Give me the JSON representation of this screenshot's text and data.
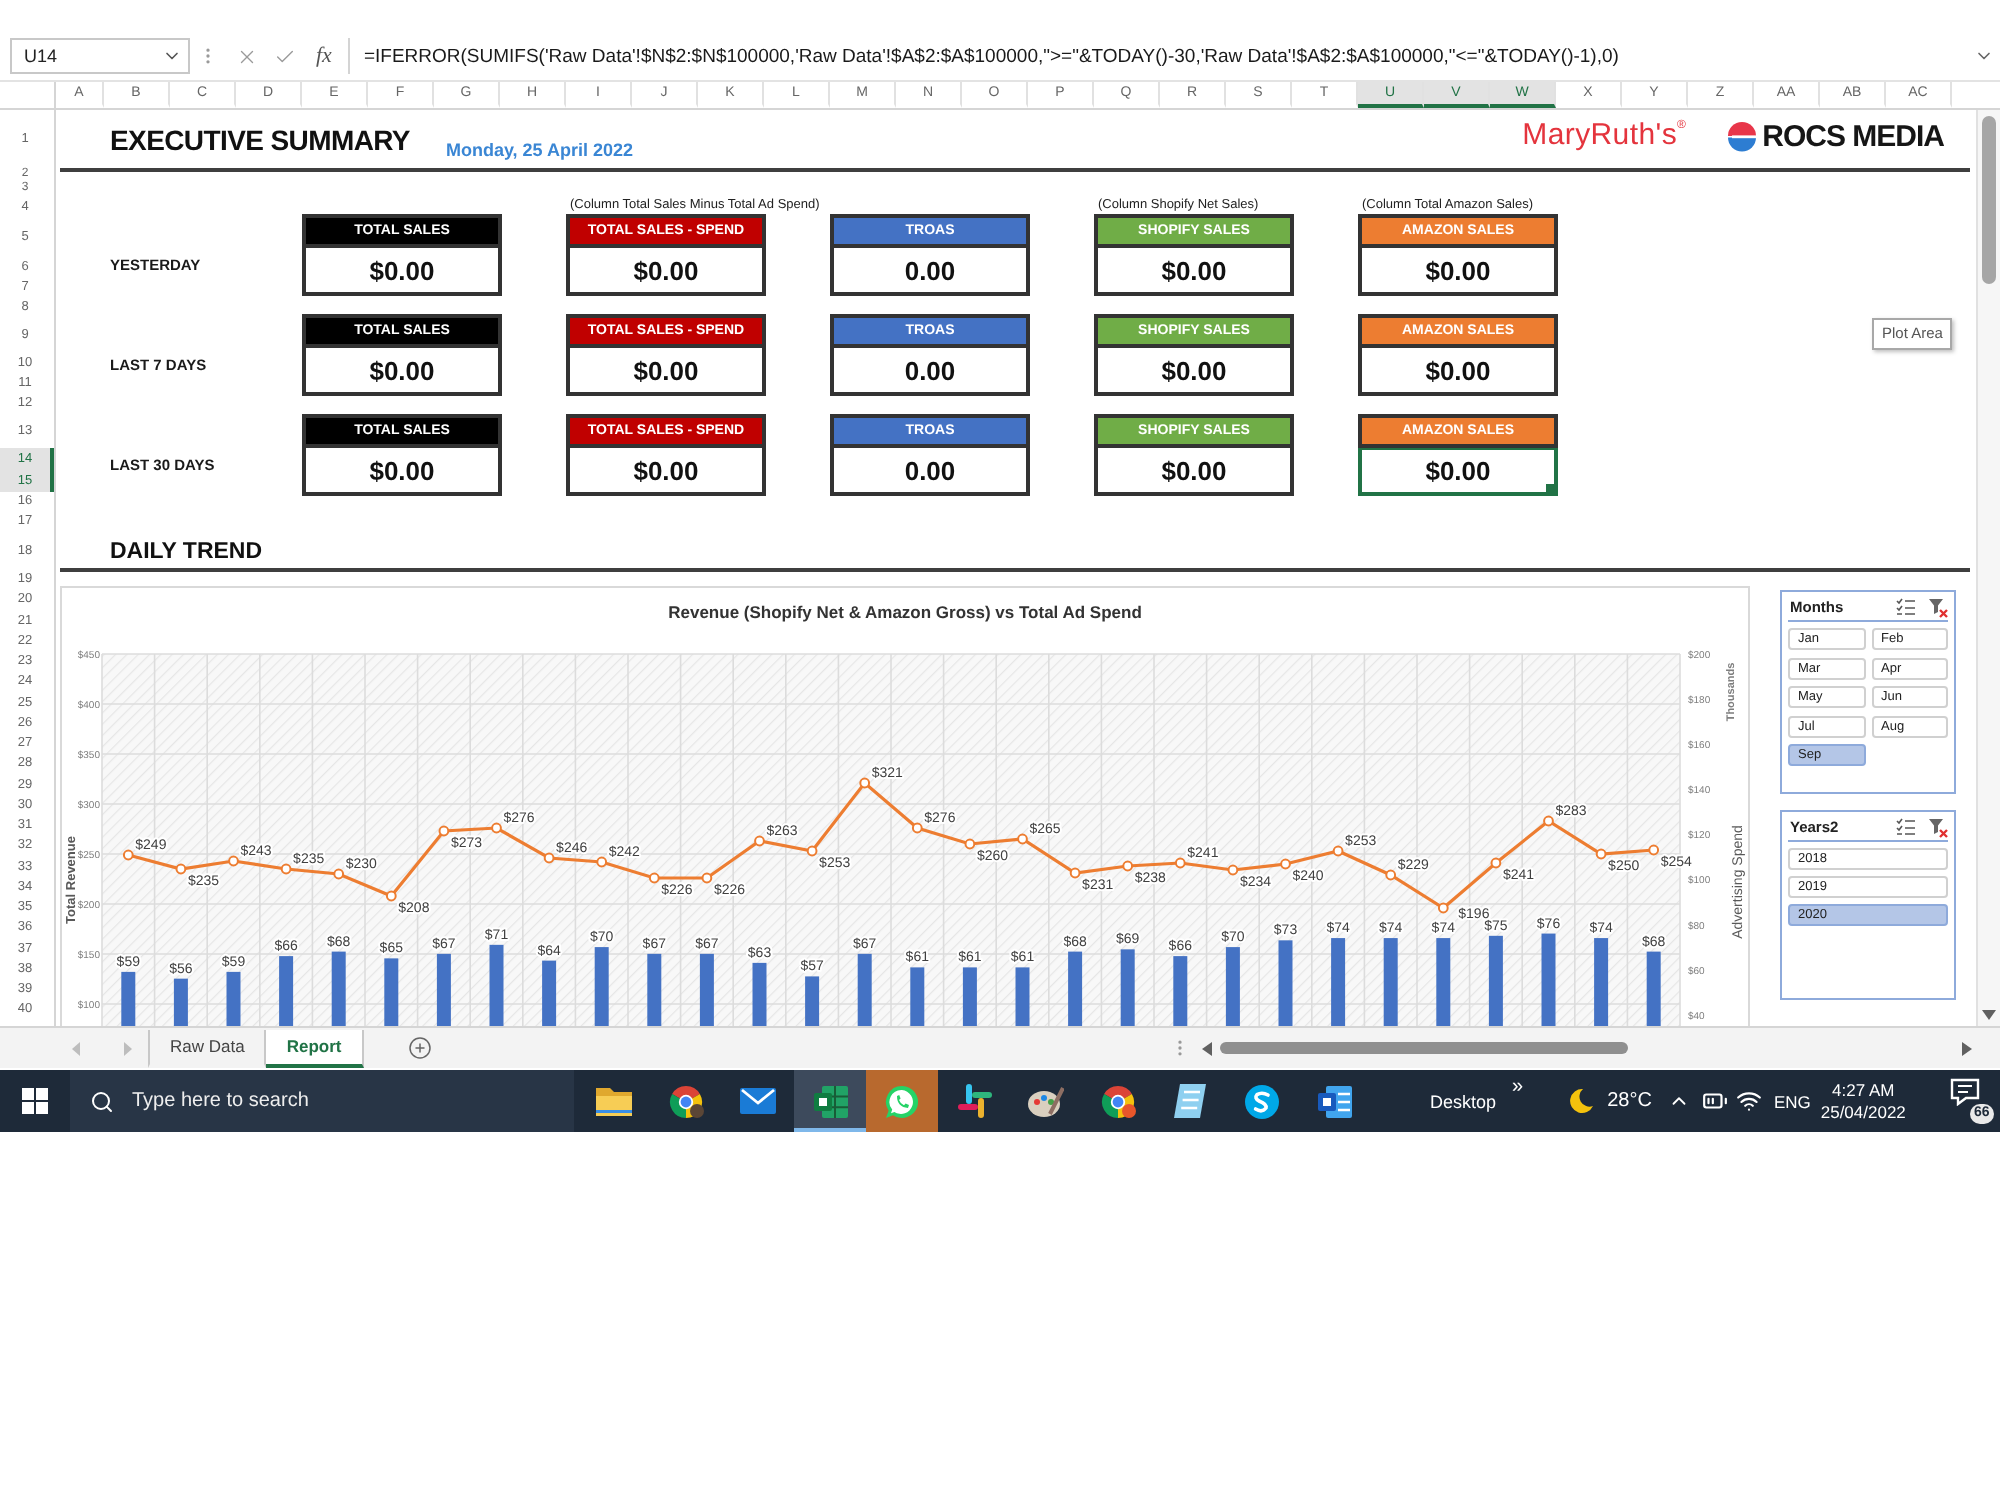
{
  "formula_bar": {
    "name_box": "U14",
    "function_label": "fx",
    "formula": "=IFERROR(SUMIFS('Raw Data'!$N$2:$N$100000,'Raw Data'!$A$2:$A$100000,\">=\"&TODAY()-30,'Raw Data'!$A$2:$A$100000,\"<=\"&TODAY()-1),0)"
  },
  "columns": [
    {
      "label": "A",
      "selected": false
    },
    {
      "label": "B",
      "selected": false
    },
    {
      "label": "C",
      "selected": false
    },
    {
      "label": "D",
      "selected": false
    },
    {
      "label": "E",
      "selected": false
    },
    {
      "label": "F",
      "selected": false
    },
    {
      "label": "G",
      "selected": false
    },
    {
      "label": "H",
      "selected": false
    },
    {
      "label": "I",
      "selected": false
    },
    {
      "label": "J",
      "selected": false
    },
    {
      "label": "K",
      "selected": false
    },
    {
      "label": "L",
      "selected": false
    },
    {
      "label": "M",
      "selected": false
    },
    {
      "label": "N",
      "selected": false
    },
    {
      "label": "O",
      "selected": false
    },
    {
      "label": "P",
      "selected": false
    },
    {
      "label": "Q",
      "selected": false
    },
    {
      "label": "R",
      "selected": false
    },
    {
      "label": "S",
      "selected": false
    },
    {
      "label": "T",
      "selected": false
    },
    {
      "label": "U",
      "selected": true
    },
    {
      "label": "V",
      "selected": true
    },
    {
      "label": "W",
      "selected": true
    },
    {
      "label": "X",
      "selected": false
    },
    {
      "label": "Y",
      "selected": false
    },
    {
      "label": "Z",
      "selected": false
    },
    {
      "label": "AA",
      "selected": false
    },
    {
      "label": "AB",
      "selected": false
    },
    {
      "label": "AC",
      "selected": false
    }
  ],
  "rows": [
    {
      "label": "1",
      "selected": false
    },
    {
      "label": "2",
      "selected": false
    },
    {
      "label": "3",
      "selected": false
    },
    {
      "label": "4",
      "selected": false
    },
    {
      "label": "5",
      "selected": false
    },
    {
      "label": "6",
      "selected": false
    },
    {
      "label": "7",
      "selected": false
    },
    {
      "label": "8",
      "selected": false
    },
    {
      "label": "9",
      "selected": false
    },
    {
      "label": "10",
      "selected": false
    },
    {
      "label": "11",
      "selected": false
    },
    {
      "label": "12",
      "selected": false
    },
    {
      "label": "13",
      "selected": false
    },
    {
      "label": "14",
      "selected": true
    },
    {
      "label": "15",
      "selected": true
    },
    {
      "label": "16",
      "selected": false
    },
    {
      "label": "17",
      "selected": false
    },
    {
      "label": "18",
      "selected": false
    },
    {
      "label": "19",
      "selected": false
    },
    {
      "label": "20",
      "selected": false
    },
    {
      "label": "21",
      "selected": false
    },
    {
      "label": "22",
      "selected": false
    },
    {
      "label": "23",
      "selected": false
    },
    {
      "label": "24",
      "selected": false
    },
    {
      "label": "25",
      "selected": false
    },
    {
      "label": "26",
      "selected": false
    },
    {
      "label": "27",
      "selected": false
    },
    {
      "label": "28",
      "selected": false
    },
    {
      "label": "29",
      "selected": false
    },
    {
      "label": "30",
      "selected": false
    },
    {
      "label": "31",
      "selected": false
    },
    {
      "label": "32",
      "selected": false
    },
    {
      "label": "33",
      "selected": false
    },
    {
      "label": "34",
      "selected": false
    },
    {
      "label": "35",
      "selected": false
    },
    {
      "label": "36",
      "selected": false
    },
    {
      "label": "37",
      "selected": false
    },
    {
      "label": "38",
      "selected": false
    },
    {
      "label": "39",
      "selected": false
    },
    {
      "label": "40",
      "selected": false
    }
  ],
  "header": {
    "title": "EXECUTIVE SUMMARY",
    "date": "Monday, 25 April 2022",
    "logos": [
      {
        "kind": "wordmark",
        "text": "MaryRuth's$^{®}$"
      },
      {
        "kind": "icon-wordmark",
        "text": "ROCS MEDIA"
      }
    ]
  },
  "summary": {
    "periods": [
      {
        "label": "YESTERDAY",
        "cards": [
          {
            "header": "TOTAL SALES",
            "value": "$0.00",
            "color": "#000000",
            "selected": false
          },
          {
            "header": "TOTAL SALES - SPEND",
            "value": "$0.00",
            "color": "#c00000",
            "selected": false,
            "note": "(Column Total Sales Minus Total Ad Spend)"
          },
          {
            "header": "TROAS",
            "value": "0.00",
            "color": "#4472c4",
            "selected": false
          },
          {
            "header": "SHOPIFY SALES",
            "value": "$0.00",
            "color": "#70ad47",
            "selected": false,
            "note": "(Column Shopify Net Sales)"
          },
          {
            "header": "AMAZON SALES",
            "value": "$0.00",
            "color": "#ed7d31",
            "selected": false,
            "note": "(Column Total Amazon Sales)"
          }
        ]
      },
      {
        "label": "LAST 7 DAYS",
        "cards": [
          {
            "header": "TOTAL SALES",
            "value": "$0.00",
            "color": "#000000",
            "selected": false
          },
          {
            "header": "TOTAL SALES - SPEND",
            "value": "$0.00",
            "color": "#c00000",
            "selected": false
          },
          {
            "header": "TROAS",
            "value": "0.00",
            "color": "#4472c4",
            "selected": false
          },
          {
            "header": "SHOPIFY SALES",
            "value": "$0.00",
            "color": "#70ad47",
            "selected": false
          },
          {
            "header": "AMAZON SALES",
            "value": "$0.00",
            "color": "#ed7d31",
            "selected": false
          }
        ]
      },
      {
        "label": "LAST 30 DAYS",
        "cards": [
          {
            "header": "TOTAL SALES",
            "value": "$0.00",
            "color": "#000000",
            "selected": false
          },
          {
            "header": "TOTAL SALES - SPEND",
            "value": "$0.00",
            "color": "#c00000",
            "selected": false
          },
          {
            "header": "TROAS",
            "value": "0.00",
            "color": "#4472c4",
            "selected": false
          },
          {
            "header": "SHOPIFY SALES",
            "value": "$0.00",
            "color": "#70ad47",
            "selected": false
          },
          {
            "header": "AMAZON SALES",
            "value": "$0.00",
            "color": "#ed7d31",
            "selected": true
          }
        ]
      }
    ]
  },
  "section_title": "DAILY TREND",
  "chart": {
    "title": "Revenue (Shopify Net & Amazon Gross) vs Total Ad Spend",
    "chart_data": {
      "type": "bar",
      "grid": true,
      "ylabel": "Total Revenue",
      "y2label": "Advertising Spend",
      "ylim": [
        78,
        450
      ],
      "y2lim": [
        35,
        200
      ],
      "yticks": [
        {
          "value": 100,
          "label": "$100"
        },
        {
          "value": 150,
          "label": "$150"
        },
        {
          "value": 200,
          "label": "$200"
        },
        {
          "value": 250,
          "label": "$250"
        },
        {
          "value": 300,
          "label": "$300"
        },
        {
          "value": 350,
          "label": "$350"
        },
        {
          "value": 400,
          "label": "$400"
        },
        {
          "value": 450,
          "label": "$450"
        }
      ],
      "y2ticks": [
        {
          "value": 40,
          "label": "$40"
        },
        {
          "value": 60,
          "label": "$60"
        },
        {
          "value": 80,
          "label": "$80"
        },
        {
          "value": 100,
          "label": "$100"
        },
        {
          "value": 120,
          "label": "$120"
        },
        {
          "value": 140,
          "label": "$140"
        },
        {
          "value": 160,
          "label": "$160"
        },
        {
          "value": 180,
          "label": "$180"
        },
        {
          "value": 200,
          "label": "$200"
        }
      ],
      "annotations": [
        {
          "text": "Thousands"
        }
      ],
      "series": [
        {
          "axis": "y2",
          "color": "#4472c4",
          "values": [
            59,
            56,
            59,
            66,
            68,
            65,
            67,
            71,
            64,
            70,
            67,
            67,
            63,
            57,
            67,
            61,
            61,
            61,
            68,
            69,
            66,
            70,
            73,
            74,
            74,
            74,
            75,
            76,
            74,
            68
          ],
          "value_labels": [
            "$59",
            "$56",
            "$59",
            "$66",
            "$68",
            "$65",
            "$67",
            "$71",
            "$64",
            "$70",
            "$67",
            "$67",
            "$63",
            "$57",
            "$67",
            "$61",
            "$61",
            "$61",
            "$68",
            "$69",
            "$66",
            "$70",
            "$73",
            "$74",
            "$74",
            "$74",
            "$75",
            "$76",
            "$74",
            "$68"
          ]
        },
        {
          "type": "line",
          "marker": "circle",
          "color": "#ed7d31",
          "values": [
            249,
            235,
            243,
            235,
            230,
            208,
            273,
            276,
            246,
            242,
            226,
            226,
            263,
            253,
            321,
            276,
            260,
            265,
            231,
            238,
            241,
            234,
            240,
            253,
            229,
            196,
            241,
            283,
            250,
            254
          ],
          "value_labels": [
            "$249",
            "$235",
            "$243",
            "$235",
            "$230",
            "$208",
            "$273",
            "$276",
            "$246",
            "$242",
            "$226",
            "$226",
            "$263",
            "$253",
            "$321",
            "$276",
            "$260",
            "$265",
            "$231",
            "$238",
            "$241",
            "$234",
            "$240",
            "$253",
            "$229",
            "$196",
            "$241",
            "$283",
            "$250",
            "$254"
          ]
        }
      ]
    }
  },
  "slicers": [
    {
      "title": "Months",
      "kind": "grid",
      "items": [
        {
          "label": "Jan",
          "selected": false
        },
        {
          "label": "Feb",
          "selected": false
        },
        {
          "label": "Mar",
          "selected": false
        },
        {
          "label": "Apr",
          "selected": false
        },
        {
          "label": "May",
          "selected": false
        },
        {
          "label": "Jun",
          "selected": false
        },
        {
          "label": "Jul",
          "selected": false
        },
        {
          "label": "Aug",
          "selected": false
        },
        {
          "label": "Sep",
          "selected": true
        }
      ]
    },
    {
      "title": "Years2",
      "kind": "list",
      "items": [
        {
          "label": "2018",
          "selected": false
        },
        {
          "label": "2019",
          "selected": false
        },
        {
          "label": "2020",
          "selected": true
        }
      ]
    }
  ],
  "tooltip": "Plot Area",
  "sheet_tabs": [
    {
      "label": "Raw Data",
      "selected": false
    },
    {
      "label": "Report",
      "selected": true
    }
  ],
  "taskbar": {
    "search": {
      "placeholder": "Type here to search"
    },
    "apps": [
      {
        "kind": "folder",
        "selected": false,
        "attention": false
      },
      {
        "kind": "browser",
        "selected": false,
        "attention": false,
        "badge": {
          "color": "#5b4636"
        }
      },
      {
        "kind": "mail",
        "selected": false,
        "attention": false
      },
      {
        "kind": "spreadsheet",
        "selected": true,
        "attention": false
      },
      {
        "kind": "chat",
        "selected": false,
        "attention": true
      },
      {
        "kind": "hash",
        "selected": false,
        "attention": false
      },
      {
        "kind": "palette",
        "selected": false,
        "attention": false
      },
      {
        "kind": "browser",
        "selected": false,
        "attention": false,
        "badge": {
          "color": "#e8562a"
        }
      },
      {
        "kind": "notepad",
        "selected": false,
        "attention": false
      },
      {
        "kind": "swirl",
        "selected": false,
        "attention": false
      },
      {
        "kind": "document",
        "selected": false,
        "attention": false
      }
    ],
    "desktop_label": "Desktop",
    "more": "»",
    "temperature": "28°C",
    "language": "ENG",
    "time": "4:27 AM",
    "date": "25/04/2022",
    "notification_count": "66"
  }
}
